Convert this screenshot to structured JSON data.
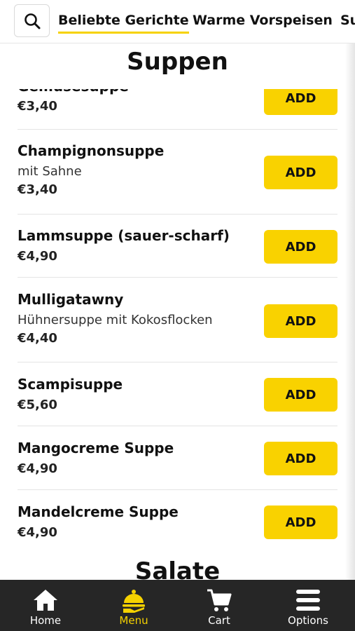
{
  "tabs": [
    {
      "label": "Beliebte Gerichte",
      "active": true
    },
    {
      "label": "Warme Vorspeisen",
      "active": false
    },
    {
      "label": "Suppen",
      "active": false
    }
  ],
  "sections": {
    "suppen_title": "Suppen",
    "salate_title": "Salate"
  },
  "menu_items": [
    {
      "name": "Gemüsesuppe",
      "description": "",
      "price": "€3,40",
      "button": "ADD"
    },
    {
      "name": "Champignonsuppe",
      "description": "mit Sahne",
      "price": "€3,40",
      "button": "ADD"
    },
    {
      "name": "Lammsuppe (sauer-scharf)",
      "description": "",
      "price": "€4,90",
      "button": "ADD"
    },
    {
      "name": "Mulligatawny",
      "description": "Hühnersuppe mit Kokosflocken",
      "price": "€4,40",
      "button": "ADD"
    },
    {
      "name": "Scampisuppe",
      "description": "",
      "price": "€5,60",
      "button": "ADD"
    },
    {
      "name": "Mangocreme Suppe",
      "description": "",
      "price": "€4,90",
      "button": "ADD"
    },
    {
      "name": "Mandelcreme Suppe",
      "description": "",
      "price": "€4,90",
      "button": "ADD"
    }
  ],
  "bottom_nav": [
    {
      "label": "Home",
      "icon": "home-icon",
      "active": false
    },
    {
      "label": "Menu",
      "icon": "cloche-icon",
      "active": true
    },
    {
      "label": "Cart",
      "icon": "cart-icon",
      "active": false
    },
    {
      "label": "Options",
      "icon": "menu-lines-icon",
      "active": false
    }
  ],
  "colors": {
    "accent": "#f9d200",
    "nav_background": "#262626",
    "nav_active": "#f6d200"
  }
}
